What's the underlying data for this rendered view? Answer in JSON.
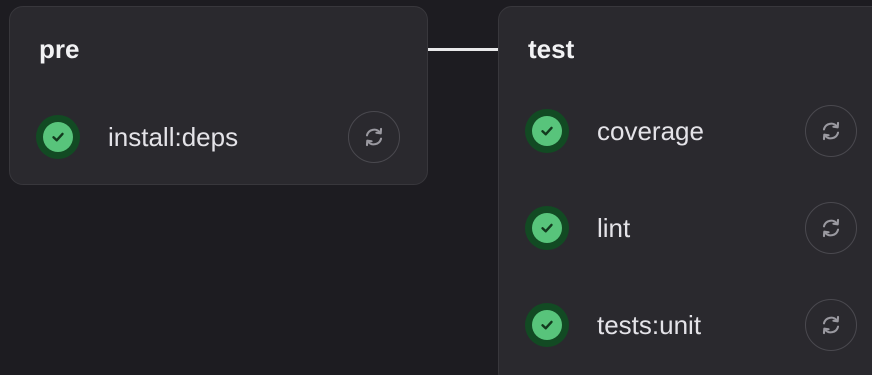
{
  "stages": [
    {
      "title": "pre",
      "jobs": [
        {
          "name": "install:deps",
          "status": "success",
          "action_icon": "retry-icon"
        }
      ]
    },
    {
      "title": "test",
      "jobs": [
        {
          "name": "coverage",
          "status": "success",
          "action_icon": "retry-icon"
        },
        {
          "name": "lint",
          "status": "success",
          "action_icon": "retry-icon"
        },
        {
          "name": "tests:unit",
          "status": "success",
          "action_icon": "retry-icon"
        }
      ]
    }
  ],
  "colors": {
    "background": "#1d1c21",
    "card": "#2a292e",
    "success": "#58c47b",
    "success_ring": "#124a23",
    "connector": "#e8e8ea"
  }
}
